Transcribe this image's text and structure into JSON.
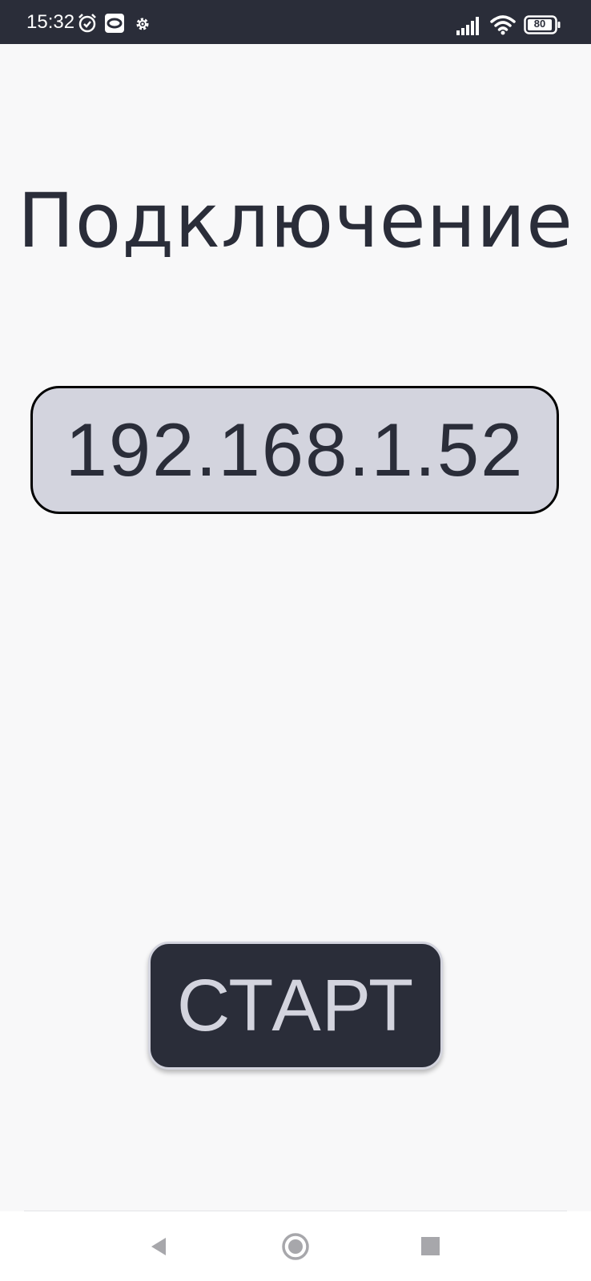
{
  "status_bar": {
    "time": "15:32",
    "battery": "80",
    "icons": [
      "alarm-icon",
      "notification-app-icon",
      "settings-gear-icon",
      "signal-icon",
      "wifi-icon",
      "battery-icon"
    ]
  },
  "main": {
    "title": "Подключение",
    "ip_address": "192.168.1.52",
    "start_label": "СТАРТ"
  },
  "nav_bar": {
    "buttons": [
      "back-icon",
      "home-icon",
      "recents-icon"
    ]
  },
  "colors": {
    "status_bar_bg": "#2a2d39",
    "background": "#f8f8f9",
    "text_dark": "#2a2d39",
    "field_bg": "#d3d4de",
    "button_bg": "#2a2d39",
    "button_text": "#d3d4de"
  }
}
